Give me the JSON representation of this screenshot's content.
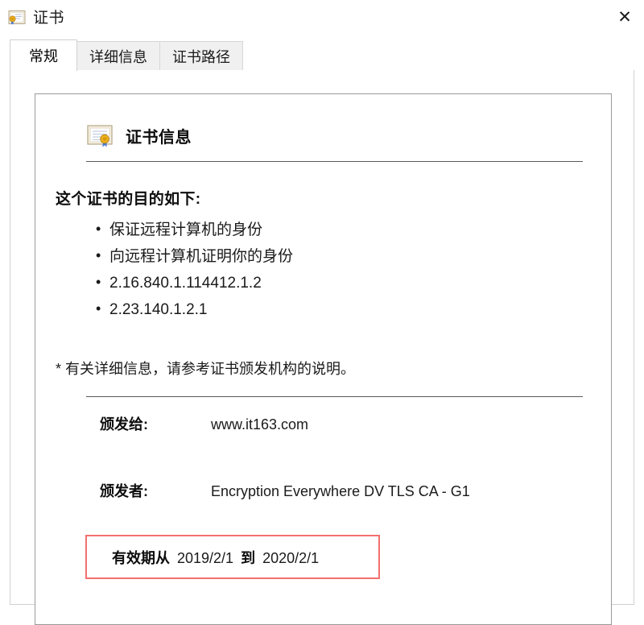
{
  "window": {
    "title": "证书",
    "title_icon": "certificate-icon",
    "close_label": "✕"
  },
  "tabs": [
    {
      "label": "常规",
      "active": true
    },
    {
      "label": "详细信息",
      "active": false
    },
    {
      "label": "证书路径",
      "active": false
    }
  ],
  "general": {
    "header_icon": "certificate-icon",
    "header_title": "证书信息",
    "purpose_title": "这个证书的目的如下:",
    "purposes": [
      "保证远程计算机的身份",
      "向远程计算机证明你的身份",
      "2.16.840.1.114412.1.2",
      "2.23.140.1.2.1"
    ],
    "footnote": "* 有关详细信息，请参考证书颁发机构的说明。",
    "issued_to_label": "颁发给:",
    "issued_to_value": "www.it163.com",
    "issued_by_label": "颁发者:",
    "issued_by_value": "Encryption Everywhere DV TLS CA - G1",
    "validity_prefix": "有效期从",
    "valid_from": "2019/2/1",
    "validity_middle": "到",
    "valid_to": "2020/2/1"
  },
  "colors": {
    "highlight_border": "#f2706e",
    "tab_inactive_bg": "#f0f0f0",
    "card_border": "#9a9a9a",
    "rule": "#5a5a5a",
    "seal_gold": "#e8a317",
    "ribbon_blue": "#3a6fc4"
  }
}
